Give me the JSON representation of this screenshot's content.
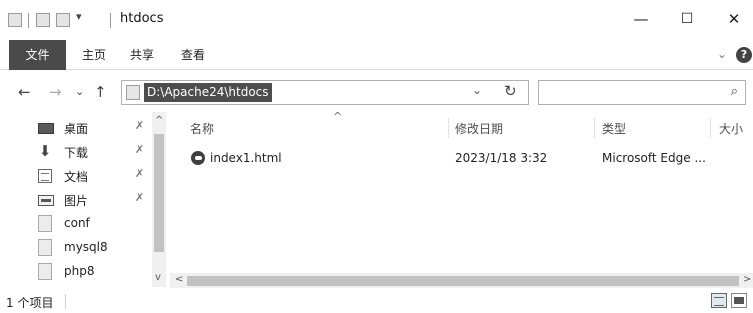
{
  "window": {
    "title": "htdocs",
    "minimize": "—",
    "maximize": "☐",
    "close": "✕"
  },
  "ribbon": {
    "tabs": [
      "文件",
      "主页",
      "共享",
      "查看"
    ],
    "expand": "⌄",
    "help": "?"
  },
  "address": {
    "back": "←",
    "forward": "→",
    "recent": "⌄",
    "up": "↑",
    "path": "D:\\Apache24\\htdocs",
    "dropdown": "⌄",
    "refresh": "↻",
    "search_placeholder": "",
    "search_icon": "⌕"
  },
  "nav": {
    "items": [
      {
        "label": "桌面",
        "icon": "desktop-icon",
        "pinned": true
      },
      {
        "label": "下载",
        "icon": "download-icon",
        "pinned": true
      },
      {
        "label": "文档",
        "icon": "documents-icon",
        "pinned": true
      },
      {
        "label": "图片",
        "icon": "pictures-icon",
        "pinned": true
      },
      {
        "label": "conf",
        "icon": "folder-icon",
        "pinned": false
      },
      {
        "label": "mysql8",
        "icon": "folder-icon",
        "pinned": false
      },
      {
        "label": "php8",
        "icon": "folder-icon",
        "pinned": false
      }
    ],
    "pin_glyph": "✗"
  },
  "content": {
    "columns": [
      "名称",
      "修改日期",
      "类型",
      "大小"
    ],
    "sort_glyph": "^",
    "files": [
      {
        "name": "index1.html",
        "modified": "2023/1/18 3:32",
        "type": "Microsoft Edge ...",
        "size": "",
        "icon": "edge-icon"
      }
    ]
  },
  "scroll": {
    "up": "^",
    "down": "v",
    "left": "<",
    "right": ">"
  },
  "status": {
    "item_count": "1 个项目"
  }
}
